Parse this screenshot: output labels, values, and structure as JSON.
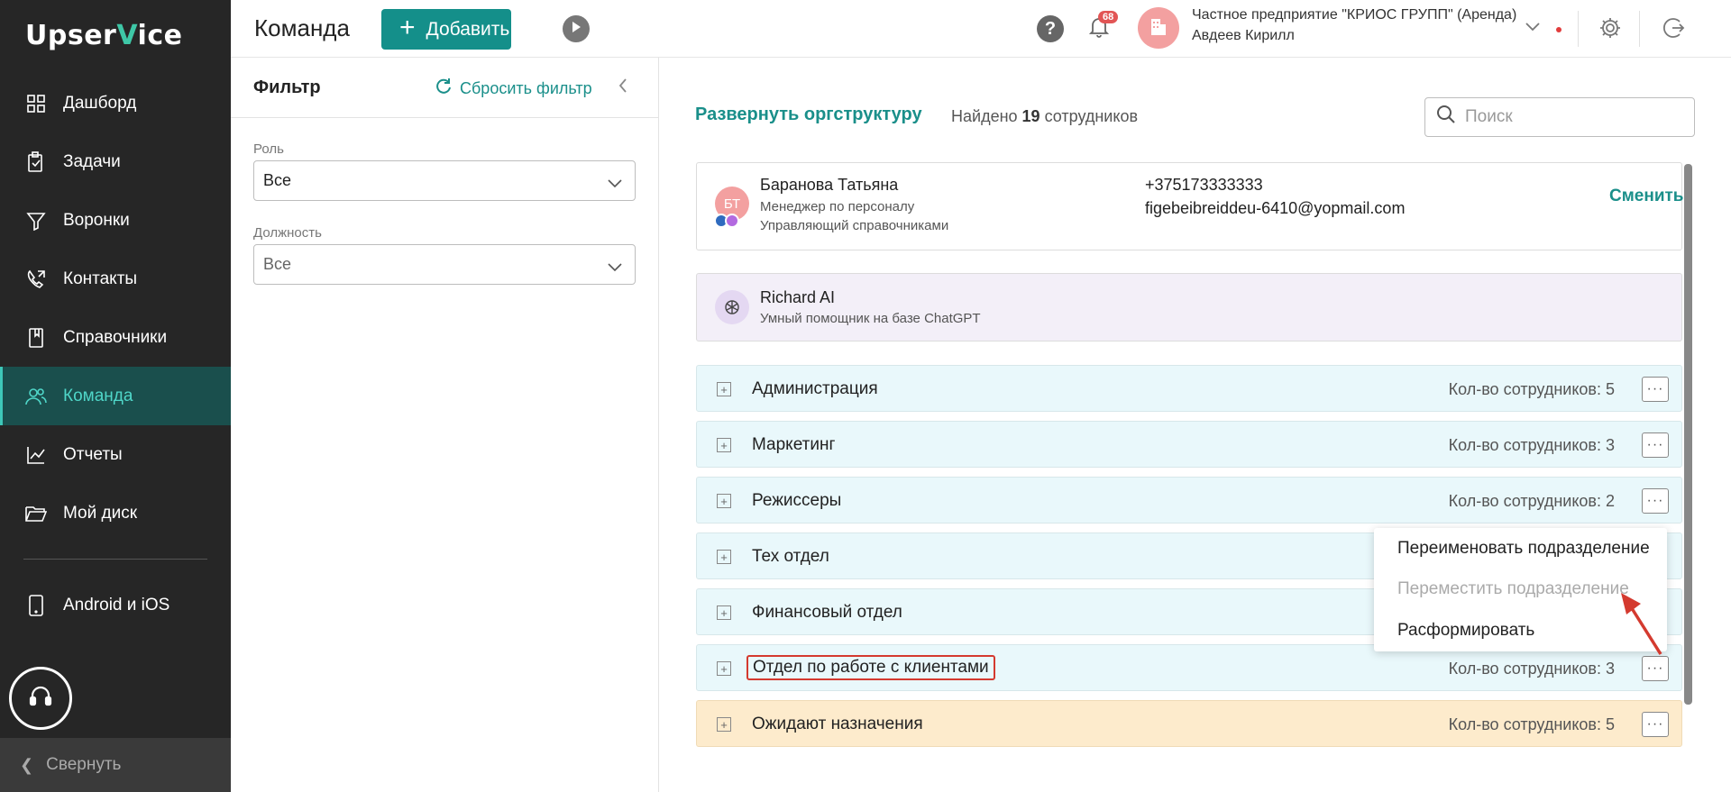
{
  "brand": {
    "logo_part1": "Upser",
    "logo_check": "V",
    "logo_part2": "ice"
  },
  "sidebar": {
    "items": [
      {
        "label": "Дашборд",
        "icon": "dashboard-icon"
      },
      {
        "label": "Задачи",
        "icon": "tasks-icon"
      },
      {
        "label": "Воронки",
        "icon": "funnel-icon"
      },
      {
        "label": "Контакты",
        "icon": "contacts-icon"
      },
      {
        "label": "Справочники",
        "icon": "book-icon"
      },
      {
        "label": "Команда",
        "icon": "team-icon",
        "active": true
      },
      {
        "label": "Отчеты",
        "icon": "chart-icon"
      },
      {
        "label": "Мой диск",
        "icon": "folder-icon"
      }
    ],
    "mobile_label": "Android и iOS",
    "collapse_label": "Свернуть"
  },
  "header": {
    "title": "Команда",
    "add_label": "Добавить",
    "notifications_count": "68",
    "org_name": "Частное предприятие \"КРИОС ГРУПП\" (Аренда)",
    "user_name": "Авдеев Кирилл"
  },
  "filter": {
    "title": "Фильтр",
    "reset_label": "Сбросить фильтр",
    "role_label": "Роль",
    "role_value": "Все",
    "position_label": "Должность",
    "position_value": "Все"
  },
  "main": {
    "expand_label": "Развернуть оргструктуру",
    "found_prefix": "Найдено",
    "found_count": "19",
    "found_suffix": "сотрудников",
    "search_placeholder": "Поиск",
    "user_card": {
      "initials": "БТ",
      "name": "Баранова Татьяна",
      "role": "Менеджер по персоналу",
      "role2": "Управляющий справочниками",
      "phone": "+375173333333",
      "email": "figebeibreiddeu-6410@yopmail.com",
      "change_label": "Сменить"
    },
    "ai_card": {
      "name": "Richard AI",
      "description": "Умный помощник на базе ChatGPT"
    },
    "departments": [
      {
        "name": "Администрация",
        "count_label": "Кол-во сотрудников: 5"
      },
      {
        "name": "Маркетинг",
        "count_label": "Кол-во сотрудников: 3"
      },
      {
        "name": "Режиссеры",
        "count_label": "Кол-во сотрудников: 2"
      },
      {
        "name": "Тех отдел",
        "count_label": ""
      },
      {
        "name": "Финансовый отдел",
        "count_label": ""
      },
      {
        "name": "Отдел по работе с клиентами",
        "count_label": "Кол-во сотрудников: 3"
      },
      {
        "name": "Ожидают назначения",
        "count_label": "Кол-во сотрудников: 5"
      }
    ],
    "context_menu": {
      "rename": "Переименовать подразделение",
      "move": "Переместить подразделение",
      "disband": "Расформировать"
    }
  },
  "colors": {
    "accent": "#148f8a",
    "sidebar_bg": "#262626",
    "dept_bg": "#e9f8fb",
    "waiting_bg": "#fdebcc",
    "highlight": "#d43a2f"
  }
}
